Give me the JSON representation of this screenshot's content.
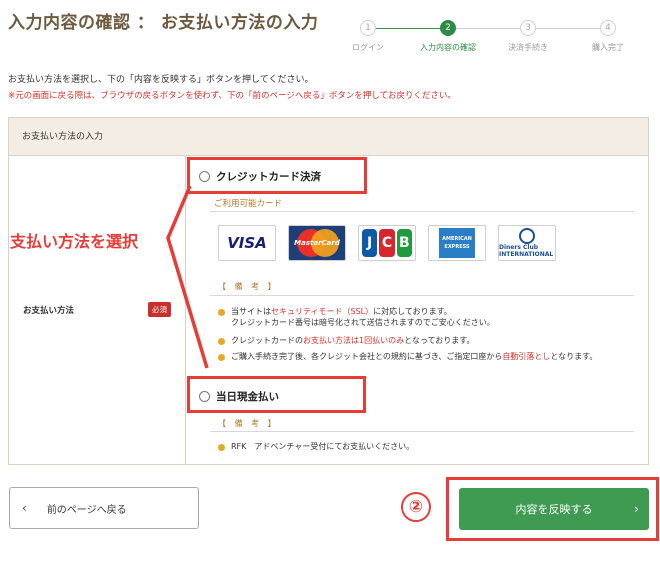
{
  "header": {
    "title": "入力内容の確認 ： お支払い方法の入力"
  },
  "steps": [
    {
      "num": "1",
      "label": "ログイン"
    },
    {
      "num": "2",
      "label": "入力内容の確認"
    },
    {
      "num": "3",
      "label": "決済手続き"
    },
    {
      "num": "4",
      "label": "購入完了"
    }
  ],
  "intro": {
    "text": "お支払い方法を選択し、下の「内容を反映する」ボタンを押してください。",
    "note": "※元の画面に戻る際は、ブラウザの戻るボタンを使わず、下の「前のページへ戻る」ボタンを押してお戻りください。"
  },
  "panel": {
    "heading": "お支払い方法の入力",
    "field_label": "お支払い方法",
    "required_badge": "必須",
    "option_credit": "クレジットカード決済",
    "cards_title": "ご利用可能カード",
    "cards": [
      "VISA",
      "MasterCard",
      "JCB",
      "AMERICAN EXPRESS",
      "Diners Club INTERNATIONAL"
    ],
    "credit_note_head": "【 備 考 】",
    "credit_notes": {
      "n1_a": "当サイトは",
      "n1_red": "セキュリティモード（SSL）",
      "n1_b": "に対応しております。",
      "n1_line2": "クレジットカード番号は暗号化されて送信されますのでご安心ください。",
      "n2_a": "クレジットカードの",
      "n2_red": "お支払い方法は1回払いのみ",
      "n2_b": "となっております。",
      "n3_a": "ご購入手続き完了後、各クレジット会社との規約に基づき、ご指定口座から",
      "n3_red": "自動引落とし",
      "n3_b": "となります。"
    },
    "option_cash": "当日現金払い",
    "cash_note_head": "【 備 考 】",
    "cash_note": "RFK　アドベンチャー受付にてお支払いください。"
  },
  "annotation": {
    "callout": "支払い方法を選択",
    "marker": "②"
  },
  "footer": {
    "back_label": "前のページへ戻る",
    "submit_label": "内容を反映する"
  }
}
